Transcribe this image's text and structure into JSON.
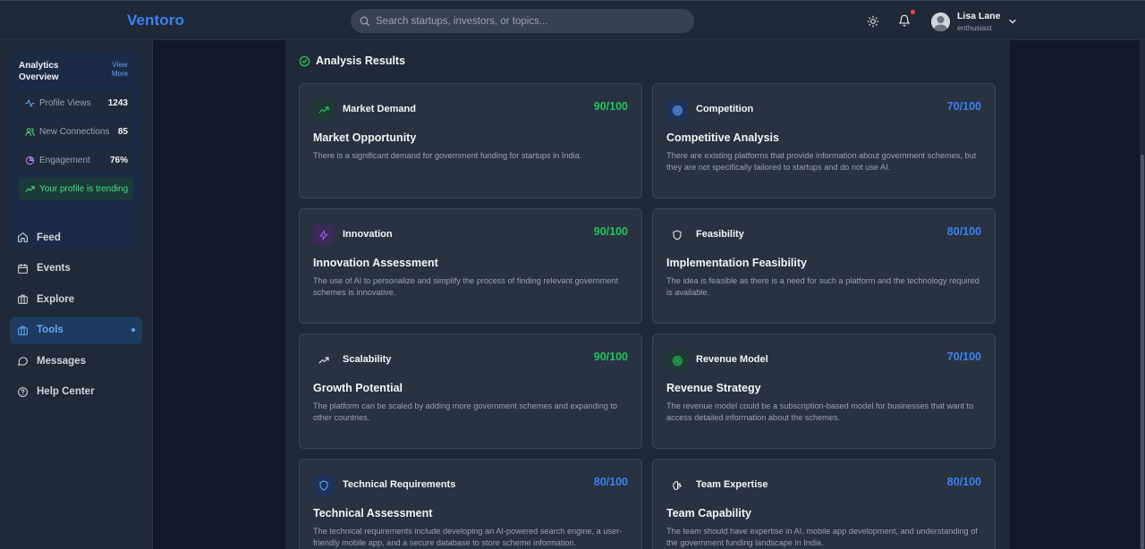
{
  "app": {
    "logo": "Ventoro"
  },
  "search": {
    "placeholder": "Search startups, investors, or topics..."
  },
  "user": {
    "name": "Lisa Lane",
    "role": "enthusiast"
  },
  "analytics": {
    "title": "Analytics Overview",
    "view_more": "View More",
    "stats": [
      {
        "label": "Profile Views",
        "value": "1243",
        "icon": "activity-icon"
      },
      {
        "label": "New Connections",
        "value": "85",
        "icon": "users-icon"
      },
      {
        "label": "Engagement",
        "value": "76%",
        "icon": "pie-chart-icon"
      }
    ],
    "trending": "Your profile is trending"
  },
  "nav": {
    "items": [
      {
        "label": "Feed",
        "icon": "home-icon"
      },
      {
        "label": "Events",
        "icon": "calendar-icon"
      },
      {
        "label": "Explore",
        "icon": "briefcase-icon"
      },
      {
        "label": "Tools",
        "icon": "toolbox-icon",
        "active": true
      },
      {
        "label": "Messages",
        "icon": "message-icon"
      },
      {
        "label": "Help Center",
        "icon": "help-icon"
      }
    ]
  },
  "results": {
    "heading": "Analysis Results",
    "cards": [
      {
        "category": "Market Demand",
        "score": "90/100",
        "title": "Market Opportunity",
        "description": "There is a significant demand for government funding for startups in India.",
        "color": "#22c55e",
        "icon": "trending-up-icon"
      },
      {
        "category": "Competition",
        "score": "70/100",
        "title": "Competitive Analysis",
        "description": "There are existing platforms that provide information about government schemes, but they are not specifically tailored to startups and do not use AI.",
        "color": "#3b82f6",
        "icon": "target-icon"
      },
      {
        "category": "Innovation",
        "score": "90/100",
        "title": "Innovation Assessment",
        "description": "The use of AI to personalize and simplify the process of finding relevant government schemes is innovative.",
        "color": "#22c55e",
        "icon": "lightning-icon"
      },
      {
        "category": "Feasibility",
        "score": "80/100",
        "title": "Implementation Feasibility",
        "description": "The idea is feasible as there is a need for such a platform and the technology required is available.",
        "color": "#3b82f6",
        "icon": "shield-icon"
      },
      {
        "category": "Scalability",
        "score": "90/100",
        "title": "Growth Potential",
        "description": "The platform can be scaled by adding more government schemes and expanding to other countries.",
        "color": "#22c55e",
        "icon": "trending-up-icon"
      },
      {
        "category": "Revenue Model",
        "score": "70/100",
        "title": "Revenue Strategy",
        "description": "The revenue model could be a subscription-based model for businesses that want to access detailed information about the schemes.",
        "color": "#3b82f6",
        "icon": "target-icon"
      },
      {
        "category": "Technical Requirements",
        "score": "80/100",
        "title": "Technical Assessment",
        "description": "The technical requirements include developing an AI-powered search engine, a user-friendly mobile app, and a secure database to store scheme information.",
        "color": "#3b82f6",
        "icon": "shield-icon"
      },
      {
        "category": "Team Expertise",
        "score": "80/100",
        "title": "Team Capability",
        "description": "The team should have expertise in AI, mobile app development, and understanding of the government funding landscape in India.",
        "color": "#3b82f6",
        "icon": "brain-icon"
      }
    ]
  }
}
